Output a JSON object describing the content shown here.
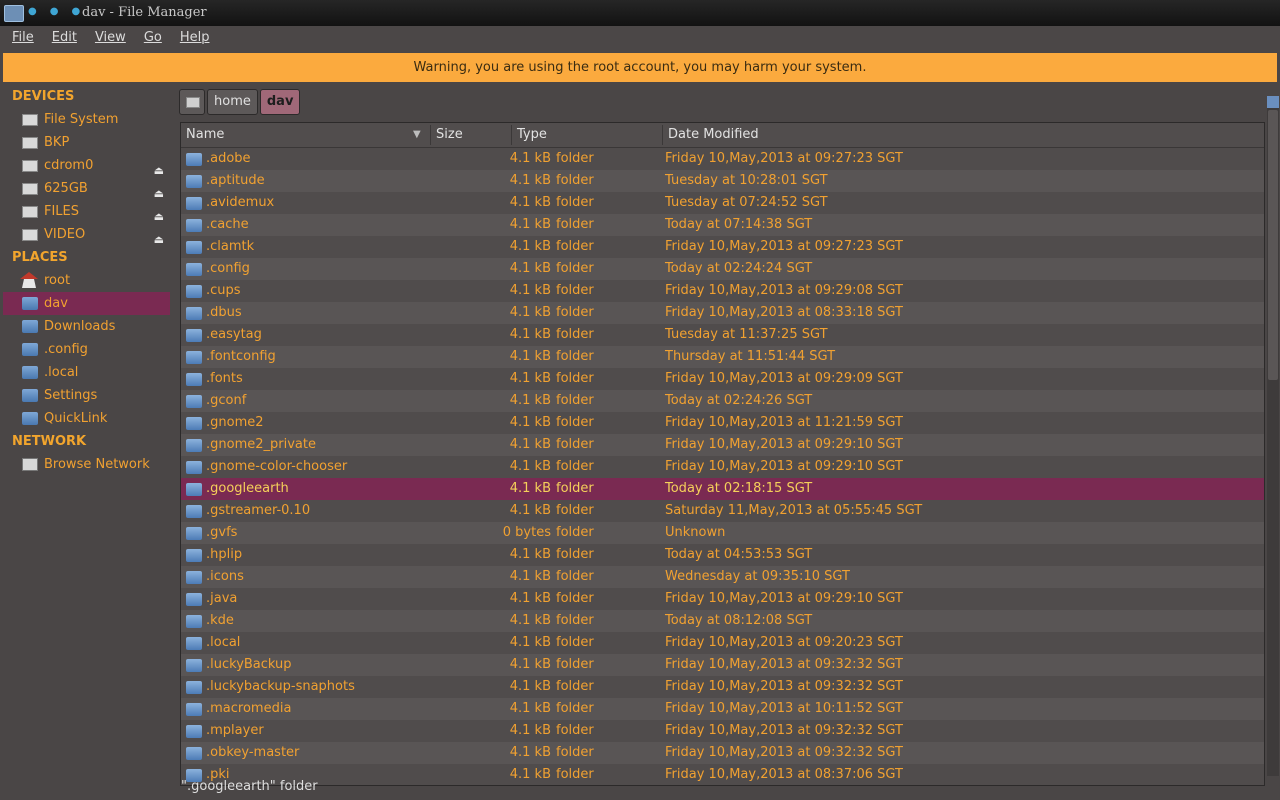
{
  "window": {
    "title": "dav - File Manager"
  },
  "menu": [
    "File",
    "Edit",
    "View",
    "Go",
    "Help"
  ],
  "warning": "Warning, you are using the root account, you may harm your system.",
  "sidebar": {
    "devices_heading": "DEVICES",
    "devices": [
      {
        "label": "File System",
        "eject": false
      },
      {
        "label": "BKP",
        "eject": false
      },
      {
        "label": "cdrom0",
        "eject": true
      },
      {
        "label": "625GB",
        "eject": true
      },
      {
        "label": "FILES",
        "eject": true
      },
      {
        "label": "VIDEO",
        "eject": true
      }
    ],
    "places_heading": "PLACES",
    "places": [
      {
        "label": "root",
        "icon": "home-icon"
      },
      {
        "label": "dav",
        "icon": "folder-icon",
        "selected": true
      },
      {
        "label": "Downloads",
        "icon": "folder-icon"
      },
      {
        "label": ".config",
        "icon": "folder-icon"
      },
      {
        "label": ".local",
        "icon": "folder-icon"
      },
      {
        "label": "Settings",
        "icon": "folder-icon"
      },
      {
        "label": "QuickLink",
        "icon": "folder-icon"
      }
    ],
    "network_heading": "NETWORK",
    "network": [
      {
        "label": "Browse Network",
        "icon": "network-icon"
      }
    ]
  },
  "pathbar": [
    "home",
    "dav"
  ],
  "columns": {
    "name": "Name",
    "size": "Size",
    "type": "Type",
    "date": "Date Modified"
  },
  "files": [
    {
      "name": ".adobe",
      "size": "4.1 kB",
      "type": "folder",
      "date": "Friday 10,May,2013 at 09:27:23  SGT"
    },
    {
      "name": ".aptitude",
      "size": "4.1 kB",
      "type": "folder",
      "date": "Tuesday at 10:28:01  SGT"
    },
    {
      "name": ".avidemux",
      "size": "4.1 kB",
      "type": "folder",
      "date": "Tuesday at 07:24:52  SGT"
    },
    {
      "name": ".cache",
      "size": "4.1 kB",
      "type": "folder",
      "date": "Today at 07:14:38  SGT"
    },
    {
      "name": ".clamtk",
      "size": "4.1 kB",
      "type": "folder",
      "date": "Friday 10,May,2013 at 09:27:23  SGT"
    },
    {
      "name": ".config",
      "size": "4.1 kB",
      "type": "folder",
      "date": "Today at 02:24:24  SGT"
    },
    {
      "name": ".cups",
      "size": "4.1 kB",
      "type": "folder",
      "date": "Friday 10,May,2013 at 09:29:08  SGT"
    },
    {
      "name": ".dbus",
      "size": "4.1 kB",
      "type": "folder",
      "date": "Friday 10,May,2013 at 08:33:18  SGT"
    },
    {
      "name": ".easytag",
      "size": "4.1 kB",
      "type": "folder",
      "date": "Tuesday at 11:37:25  SGT"
    },
    {
      "name": ".fontconfig",
      "size": "4.1 kB",
      "type": "folder",
      "date": "Thursday at 11:51:44  SGT"
    },
    {
      "name": ".fonts",
      "size": "4.1 kB",
      "type": "folder",
      "date": "Friday 10,May,2013 at 09:29:09  SGT"
    },
    {
      "name": ".gconf",
      "size": "4.1 kB",
      "type": "folder",
      "date": "Today at 02:24:26  SGT"
    },
    {
      "name": ".gnome2",
      "size": "4.1 kB",
      "type": "folder",
      "date": "Friday 10,May,2013 at 11:21:59  SGT"
    },
    {
      "name": ".gnome2_private",
      "size": "4.1 kB",
      "type": "folder",
      "date": "Friday 10,May,2013 at 09:29:10  SGT"
    },
    {
      "name": ".gnome-color-chooser",
      "size": "4.1 kB",
      "type": "folder",
      "date": "Friday 10,May,2013 at 09:29:10  SGT"
    },
    {
      "name": ".googleearth",
      "size": "4.1 kB",
      "type": "folder",
      "date": "Today at 02:18:15  SGT",
      "selected": true
    },
    {
      "name": ".gstreamer-0.10",
      "size": "4.1 kB",
      "type": "folder",
      "date": "Saturday 11,May,2013 at 05:55:45  SGT"
    },
    {
      "name": ".gvfs",
      "size": "0 bytes",
      "type": "folder",
      "date": "Unknown"
    },
    {
      "name": ".hplip",
      "size": "4.1 kB",
      "type": "folder",
      "date": "Today at 04:53:53  SGT"
    },
    {
      "name": ".icons",
      "size": "4.1 kB",
      "type": "folder",
      "date": "Wednesday at 09:35:10  SGT"
    },
    {
      "name": ".java",
      "size": "4.1 kB",
      "type": "folder",
      "date": "Friday 10,May,2013 at 09:29:10  SGT"
    },
    {
      "name": ".kde",
      "size": "4.1 kB",
      "type": "folder",
      "date": "Today at 08:12:08  SGT"
    },
    {
      "name": ".local",
      "size": "4.1 kB",
      "type": "folder",
      "date": "Friday 10,May,2013 at 09:20:23  SGT"
    },
    {
      "name": ".luckyBackup",
      "size": "4.1 kB",
      "type": "folder",
      "date": "Friday 10,May,2013 at 09:32:32  SGT"
    },
    {
      "name": ".luckybackup-snaphots",
      "size": "4.1 kB",
      "type": "folder",
      "date": "Friday 10,May,2013 at 09:32:32  SGT"
    },
    {
      "name": ".macromedia",
      "size": "4.1 kB",
      "type": "folder",
      "date": "Friday 10,May,2013 at 10:11:52  SGT"
    },
    {
      "name": ".mplayer",
      "size": "4.1 kB",
      "type": "folder",
      "date": "Friday 10,May,2013 at 09:32:32  SGT"
    },
    {
      "name": ".obkey-master",
      "size": "4.1 kB",
      "type": "folder",
      "date": "Friday 10,May,2013 at 09:32:32  SGT"
    },
    {
      "name": ".pki",
      "size": "4.1 kB",
      "type": "folder",
      "date": "Friday 10,May,2013 at 08:37:06  SGT"
    }
  ],
  "status": "\".googleearth\" folder"
}
